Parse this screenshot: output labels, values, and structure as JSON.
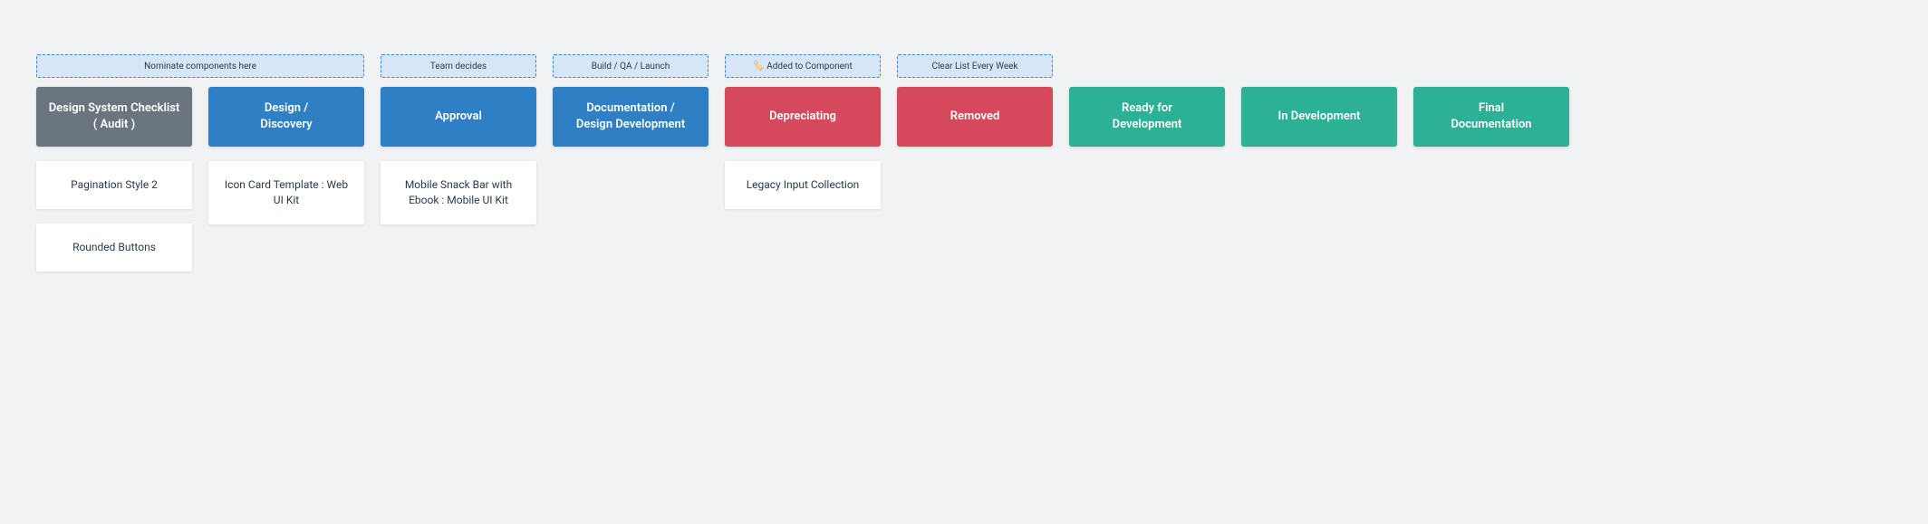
{
  "notes": {
    "nominate": "Nominate components here",
    "team": "Team decides",
    "build": "Build / QA / Launch",
    "added": "🏷️ Added to Component",
    "clear": "Clear List Every Week"
  },
  "columns": {
    "audit": {
      "title": "Design System Checklist\n( Audit )"
    },
    "design": {
      "title": "Design /\nDiscovery"
    },
    "approval": {
      "title": "Approval"
    },
    "docs": {
      "title": "Documentation /\nDesign Development"
    },
    "deprec": {
      "title": "Depreciating"
    },
    "removed": {
      "title": "Removed"
    },
    "ready": {
      "title": "Ready for\nDevelopment"
    },
    "indev": {
      "title": "In Development"
    },
    "final": {
      "title": "Final\nDocumentation"
    }
  },
  "cards": {
    "audit": [
      "Pagination  Style 2",
      "Rounded Buttons"
    ],
    "design": [
      "Icon Card Template : Web UI Kit"
    ],
    "approval": [
      "Mobile Snack Bar with Ebook : Mobile UI Kit"
    ],
    "deprec": [
      "Legacy Input Collection"
    ]
  }
}
